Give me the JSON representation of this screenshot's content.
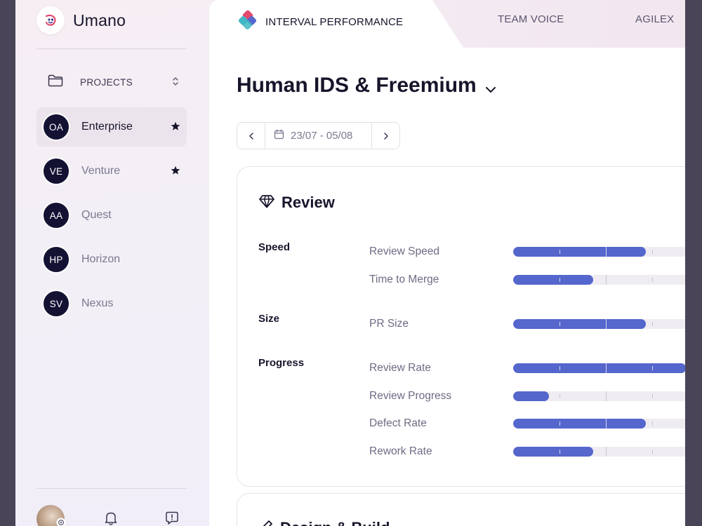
{
  "app": {
    "name": "Umano"
  },
  "colors": {
    "accent": "#5566cc",
    "avatar_bg": "#141233",
    "active_bg": "#ebe4ec"
  },
  "sidebar": {
    "section_label": "PROJECTS",
    "projects": [
      {
        "initials": "OA",
        "name": "Enterprise",
        "starred": true,
        "active": true
      },
      {
        "initials": "VE",
        "name": "Venture",
        "starred": true,
        "active": false
      },
      {
        "initials": "AA",
        "name": "Quest",
        "starred": false,
        "active": false
      },
      {
        "initials": "HP",
        "name": "Horizon",
        "starred": false,
        "active": false
      },
      {
        "initials": "SV",
        "name": "Nexus",
        "starred": false,
        "active": false
      }
    ]
  },
  "tabs": [
    {
      "label": "INTERVAL PERFORMANCE",
      "active": true
    },
    {
      "label": "TEAM VOICE",
      "active": false
    },
    {
      "label": "AGILEX",
      "active": false
    }
  ],
  "main": {
    "title": "Human IDS & Freemium",
    "date_range": "23/07 - 05/08"
  },
  "review": {
    "title": "Review",
    "groups": [
      {
        "label": "Speed",
        "metrics": [
          {
            "label": "Review Speed",
            "value": 0.63
          },
          {
            "label": "Time to Merge",
            "value": 0.38
          }
        ]
      },
      {
        "label": "Size",
        "metrics": [
          {
            "label": "PR Size",
            "value": 0.63
          }
        ]
      },
      {
        "label": "Progress",
        "metrics": [
          {
            "label": "Review Rate",
            "value": 0.82
          },
          {
            "label": "Review Progress",
            "value": 0.17
          },
          {
            "label": "Defect Rate",
            "value": 0.63
          },
          {
            "label": "Rework Rate",
            "value": 0.38
          }
        ]
      }
    ]
  },
  "next_section": {
    "title": "Design & Build"
  }
}
